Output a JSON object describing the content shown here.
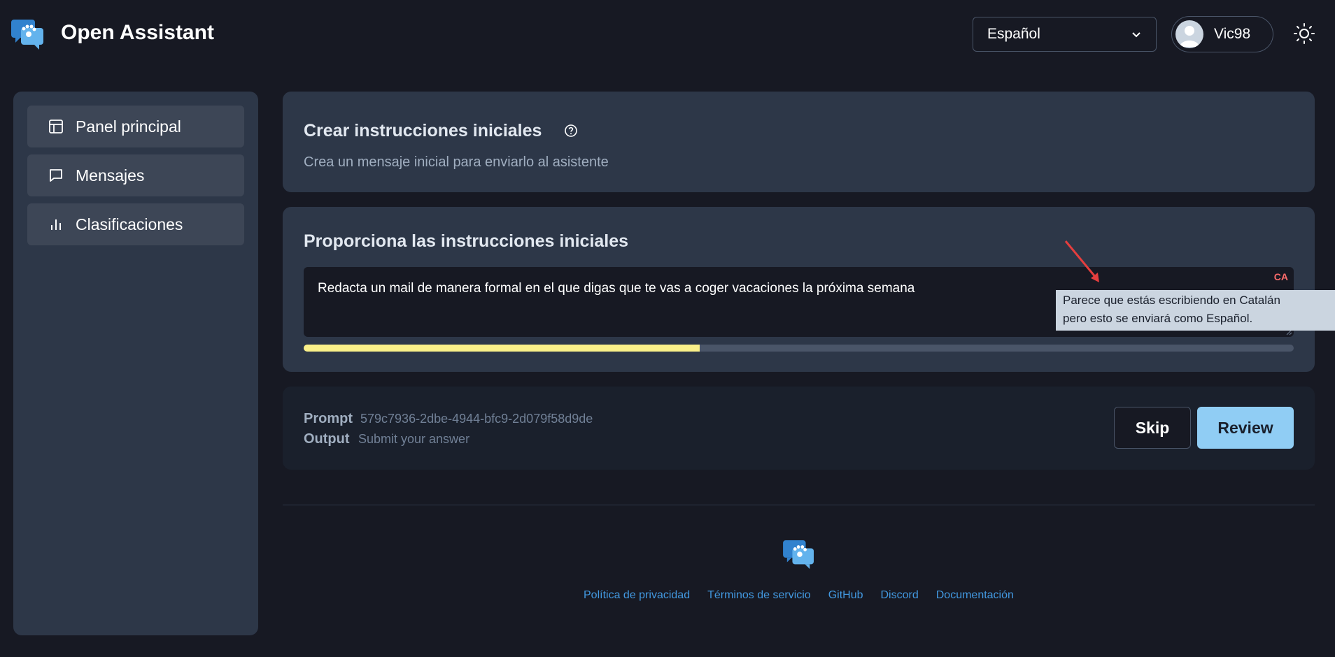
{
  "header": {
    "app_title": "Open Assistant",
    "language_selected": "Español",
    "user_name": "Vic98"
  },
  "sidebar": {
    "items": [
      {
        "label": "Panel principal",
        "icon": "layout-icon"
      },
      {
        "label": "Mensajes",
        "icon": "message-icon"
      },
      {
        "label": "Clasificaciones",
        "icon": "bar-chart-icon"
      }
    ]
  },
  "intro_card": {
    "title": "Crear instrucciones iniciales",
    "subtitle": "Crea un mensaje inicial para enviarlo al asistente"
  },
  "prompt_card": {
    "title": "Proporciona las instrucciones iniciales",
    "input_value": "Redacta un mail de manera formal en el que digas que te vas a coger vacaciones la próxima semana",
    "detected_lang_tag": "CA",
    "progress": 0.4
  },
  "task_card": {
    "prompt_label": "Prompt",
    "prompt_value": "579c7936-2dbe-4944-bfc9-2d079f58d9de",
    "output_label": "Output",
    "output_value": "Submit your answer",
    "skip_label": "Skip",
    "review_label": "Review"
  },
  "tooltip": {
    "line1": "Parece que estás escribiendo en Catalán",
    "line2": "pero esto se enviará como Español."
  },
  "footer": {
    "links": [
      "Política de privacidad",
      "Términos de servicio",
      "GitHub",
      "Discord",
      "Documentación"
    ]
  },
  "colors": {
    "accent": "#90cdf4",
    "progress": "#faf089",
    "link": "#4299e1",
    "warning_tag": "#fc6b6b"
  }
}
